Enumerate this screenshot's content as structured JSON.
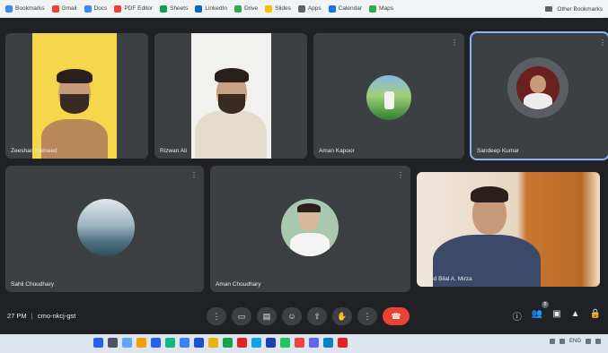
{
  "bookmarks": {
    "items": [
      {
        "label": "Bookmarks",
        "color": "#4285f4"
      },
      {
        "label": "Gmail",
        "color": "#ea4335"
      },
      {
        "label": "Docs",
        "color": "#4285f4"
      },
      {
        "label": "PDF Editor",
        "color": "#ea4335"
      },
      {
        "label": "Sheets",
        "color": "#0f9d58"
      },
      {
        "label": "LinkedIn",
        "color": "#0a66c2"
      },
      {
        "label": "Drive",
        "color": "#34a853"
      },
      {
        "label": "Slides",
        "color": "#fbbc04"
      },
      {
        "label": "Apps",
        "color": "#5f6368"
      },
      {
        "label": "Calendar",
        "color": "#1a73e8"
      },
      {
        "label": "Maps",
        "color": "#34a853"
      }
    ],
    "right_label": "Other Bookmarks"
  },
  "participants": [
    {
      "name": "Zeeshan Hameed",
      "kind": "video-yellow"
    },
    {
      "name": "Rizwan Ali",
      "kind": "video-white"
    },
    {
      "name": "Aman Kapoor",
      "kind": "avatar-field"
    },
    {
      "name": "Sandeep Kumar",
      "kind": "avatar-person",
      "active": true
    },
    {
      "name": "Sahil Choudhary",
      "kind": "avatar-mountain"
    },
    {
      "name": "Aman Choudhary",
      "kind": "avatar-selfie"
    },
    {
      "name": "Mohd Bilal A. Mirza",
      "kind": "video-room"
    }
  ],
  "controls": {
    "time": "27 PM",
    "meeting_code": "cmo-nkcj-gst",
    "buttons": [
      {
        "name": "more-icon",
        "glyph": "⋮"
      },
      {
        "name": "camera-icon",
        "glyph": "▭"
      },
      {
        "name": "captions-icon",
        "glyph": "▤"
      },
      {
        "name": "emoji-icon",
        "glyph": "☺"
      },
      {
        "name": "present-icon",
        "glyph": "⇧"
      },
      {
        "name": "hand-icon",
        "glyph": "✋"
      },
      {
        "name": "options-icon",
        "glyph": "⋮"
      }
    ],
    "end_glyph": "☎",
    "people_count": "8",
    "right_icons": [
      {
        "name": "info-icon",
        "glyph": "ⓘ"
      },
      {
        "name": "people-icon",
        "glyph": "👥"
      },
      {
        "name": "chat-icon",
        "glyph": "▣"
      },
      {
        "name": "activities-icon",
        "glyph": "▲"
      },
      {
        "name": "lock-icon",
        "glyph": "🔒"
      }
    ]
  },
  "taskbar": {
    "icons": [
      "#2563eb",
      "#4b5563",
      "#60a5fa",
      "#f59e0b",
      "#2563eb",
      "#10b981",
      "#3b82f6",
      "#1d4ed8",
      "#eab308",
      "#16a34a",
      "#dc2626",
      "#0ea5e9",
      "#1e40af",
      "#22c55e",
      "#ef4444",
      "#6366f1",
      "#0284c7",
      "#dc2626"
    ],
    "tray_text": "ENG"
  }
}
